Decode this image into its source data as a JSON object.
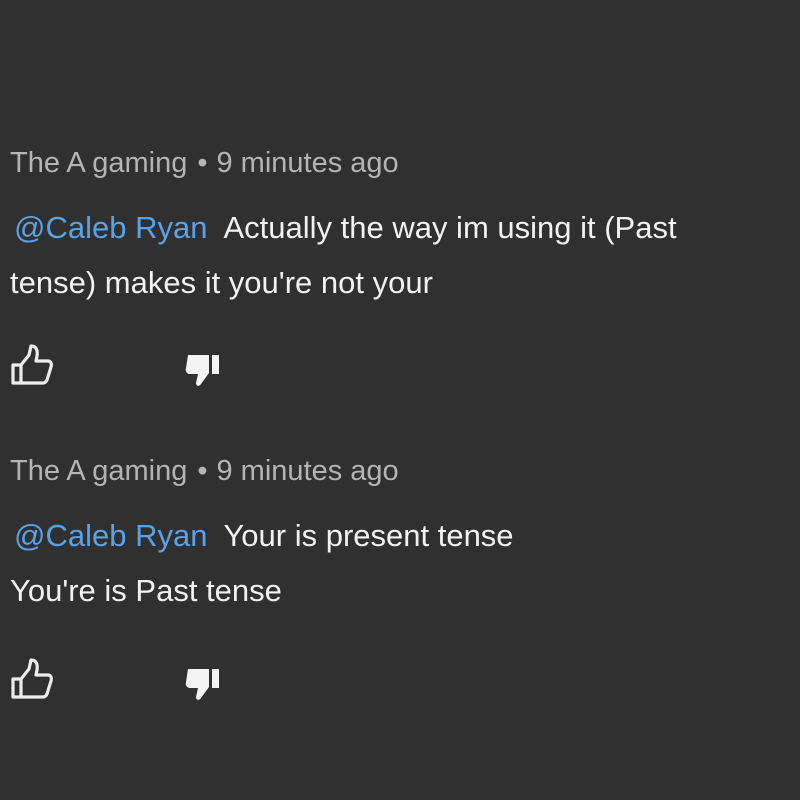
{
  "comments": [
    {
      "author": "The A gaming",
      "separator": "•",
      "time": "9 minutes ago",
      "mention": "@Caleb Ryan",
      "line1": "Actually the way im using it (Past",
      "line2": "tense) makes it you're not your",
      "like_icon": "thumbs-up-outline",
      "dislike_icon": "thumbs-down-filled"
    },
    {
      "author": "The A gaming",
      "separator": "•",
      "time": "9 minutes ago",
      "mention": "@Caleb Ryan",
      "line1": "Your is present tense",
      "line2": "You're is Past tense",
      "like_icon": "thumbs-up-outline",
      "dislike_icon": "thumbs-down-filled"
    }
  ],
  "colors": {
    "background": "#303030",
    "meta_text": "#b4b4b4",
    "body_text": "#f2f2f2",
    "mention": "#5aa2e8"
  }
}
